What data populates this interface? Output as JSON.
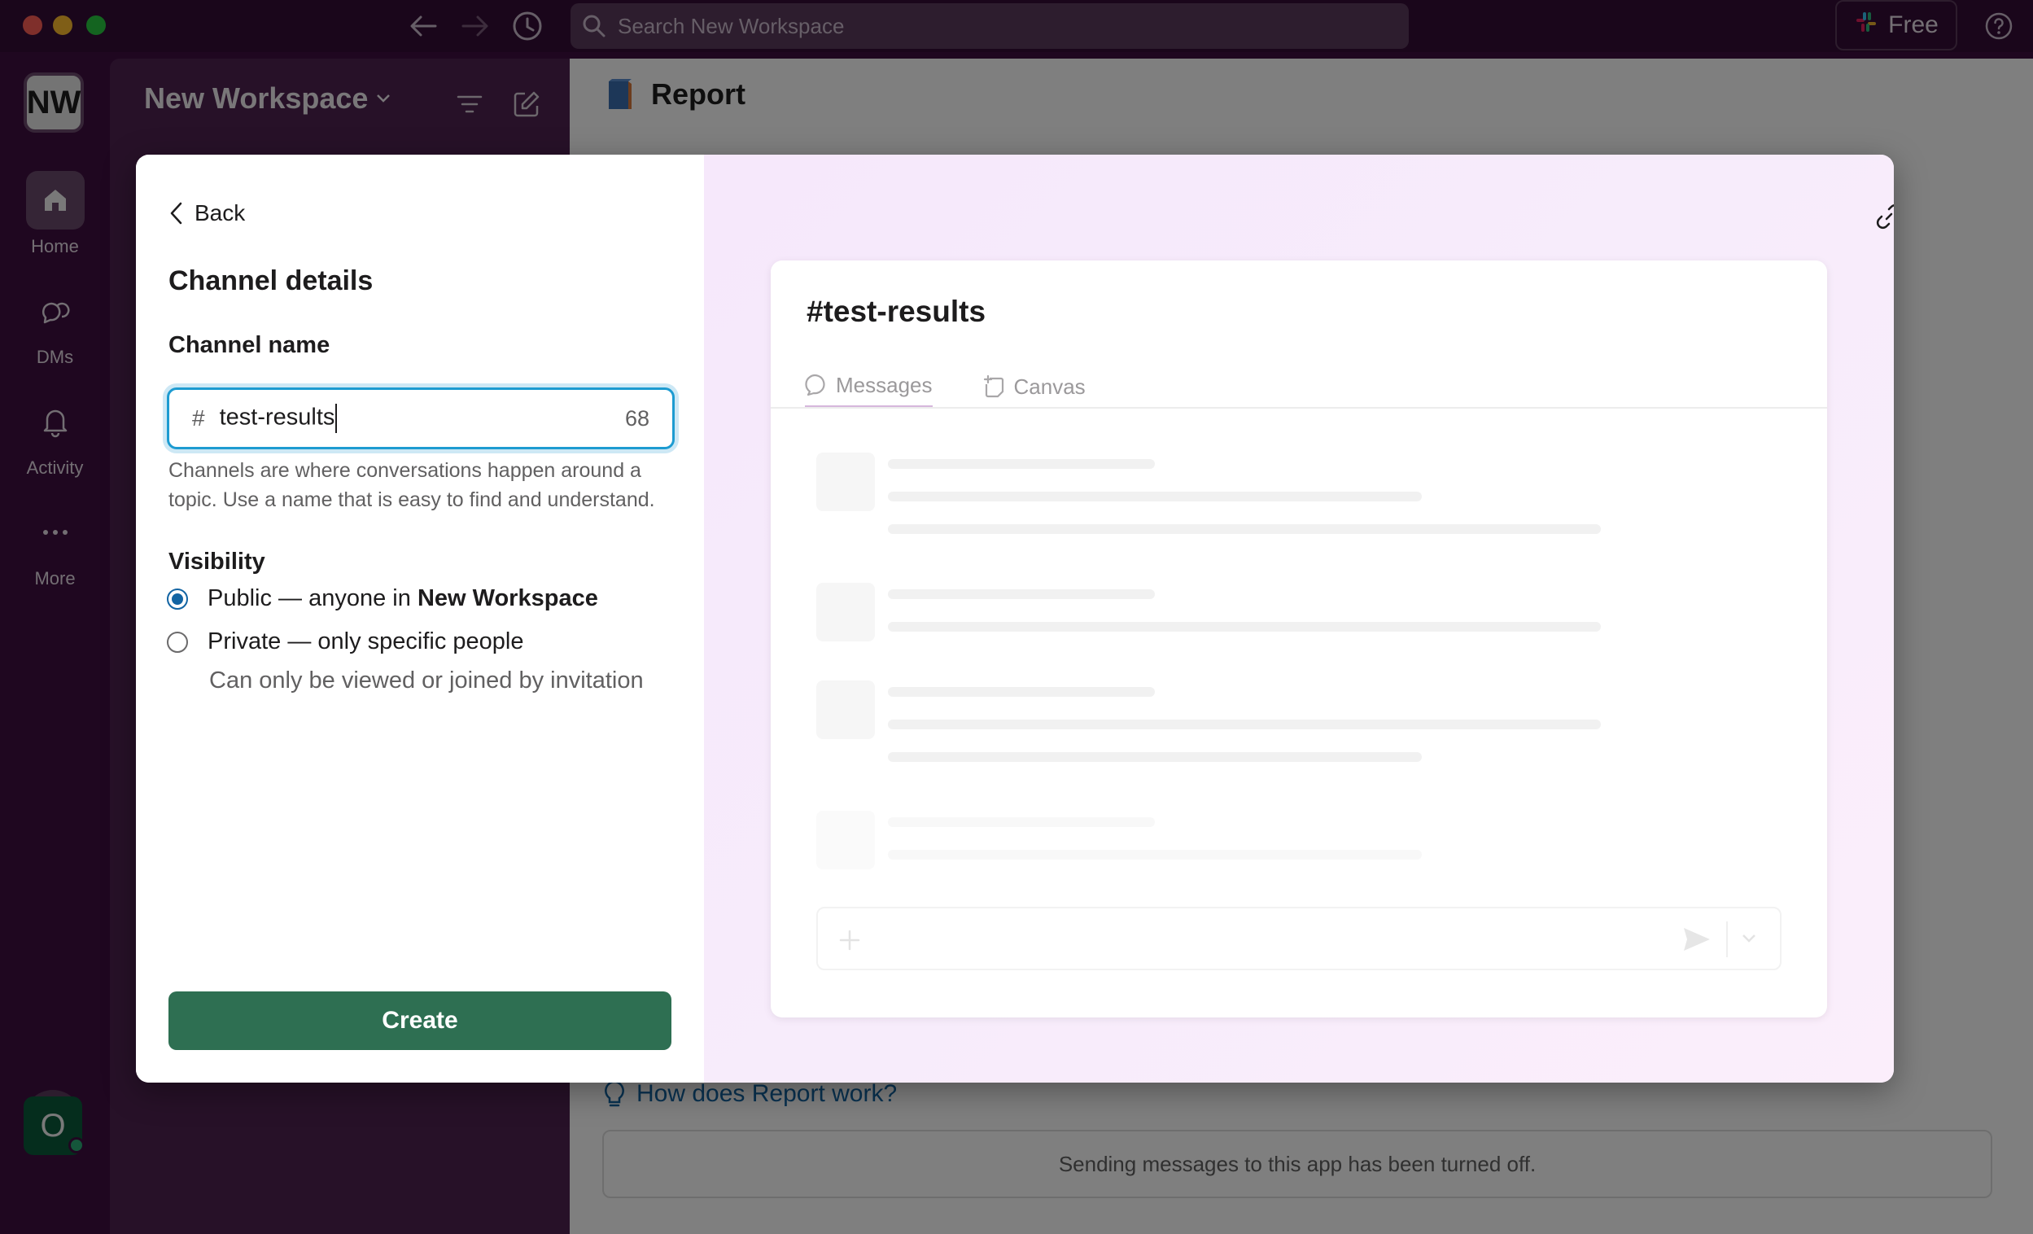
{
  "titlebar": {
    "search_placeholder": "Search New Workspace",
    "plan_label": "Free"
  },
  "rail": {
    "workspace_initials": "NW",
    "items": [
      {
        "label": "Home"
      },
      {
        "label": "DMs"
      },
      {
        "label": "Activity"
      },
      {
        "label": "More"
      }
    ],
    "user_initial": "O"
  },
  "sidebar": {
    "workspace_name": "New Workspace"
  },
  "main": {
    "app_name": "Report",
    "help_link": "How does Report work?",
    "notice": "Sending messages to this app has been turned off."
  },
  "modal": {
    "back_label": "Back",
    "title": "Channel details",
    "channel_name_label": "Channel name",
    "channel_name_value": "test-results",
    "hash_prefix": "#",
    "char_remaining": "68",
    "helper_text": "Channels are where conversations happen around a topic. Use a name that is easy to find and understand.",
    "visibility_label": "Visibility",
    "public_option_prefix": "Public — anyone in ",
    "public_option_workspace": "New Workspace",
    "private_option": "Private — only specific people",
    "private_option_sub": "Can only be viewed or joined by invitation",
    "create_label": "Create",
    "selected_visibility": "public",
    "preview": {
      "channel_title": "#test-results",
      "tabs": [
        {
          "label": "Messages",
          "active": true
        },
        {
          "label": "Canvas",
          "active": false
        }
      ]
    }
  },
  "colors": {
    "aubergine": "#3f0e40",
    "create_green": "#2e6f52",
    "link_blue": "#1264a3",
    "focus_blue": "#1d9bd1"
  }
}
